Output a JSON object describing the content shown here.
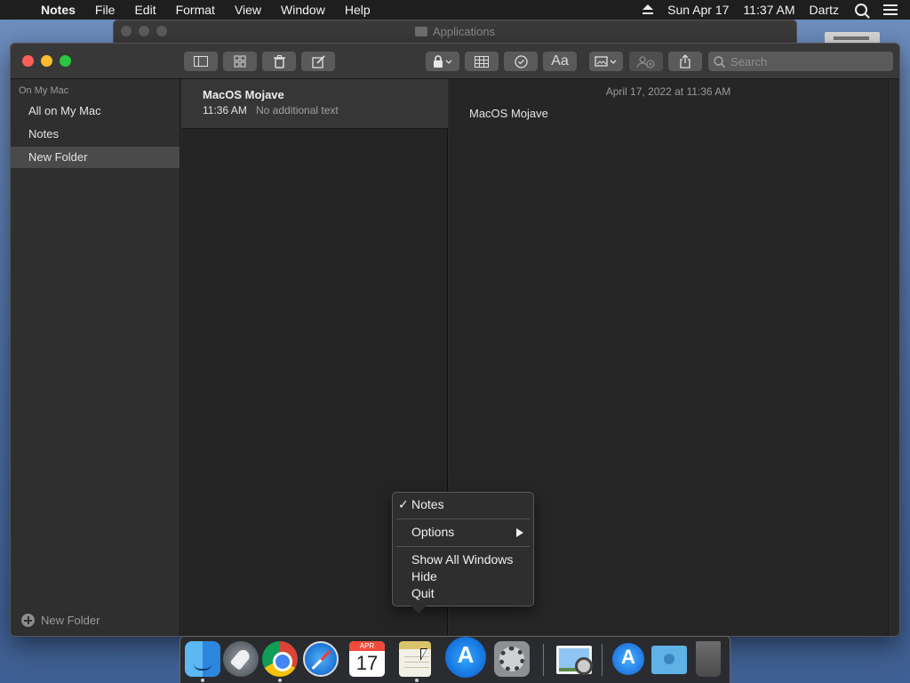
{
  "menubar": {
    "app_name": "Notes",
    "menus": [
      "File",
      "Edit",
      "Format",
      "View",
      "Window",
      "Help"
    ],
    "date": "Sun Apr 17",
    "time": "11:37 AM",
    "user": "Dartz"
  },
  "background_window": {
    "title": "Applications"
  },
  "toolbar": {
    "search_placeholder": "Search",
    "buttons": [
      "sidebar-toggle",
      "gallery-view",
      "delete",
      "compose",
      "lock",
      "table",
      "checklist",
      "format",
      "media",
      "collaborate",
      "share"
    ],
    "format_label": "Aa"
  },
  "sidebar": {
    "section_title": "On My Mac",
    "items": [
      {
        "label": "All on My Mac",
        "selected": false
      },
      {
        "label": "Notes",
        "selected": false
      },
      {
        "label": "New Folder",
        "selected": true
      }
    ],
    "new_folder_label": "New Folder"
  },
  "notes_list": [
    {
      "title": "MacOS Mojave",
      "time": "11:36 AM",
      "preview": "No additional text"
    }
  ],
  "editor": {
    "date": "April 17, 2022 at 11:36 AM",
    "body": "MacOS Mojave"
  },
  "dock_menu": {
    "check": "✓",
    "items": [
      "Notes",
      "Options",
      "Show All Windows",
      "Hide",
      "Quit"
    ]
  },
  "dock": {
    "apps": [
      "Finder",
      "Launchpad",
      "Google Chrome",
      "Safari",
      "Calendar",
      "Notes",
      "App Store",
      "System Preferences",
      "Preview",
      "App Store",
      "Downloads",
      "Trash"
    ],
    "calendar_month": "APR",
    "calendar_day": "17"
  }
}
